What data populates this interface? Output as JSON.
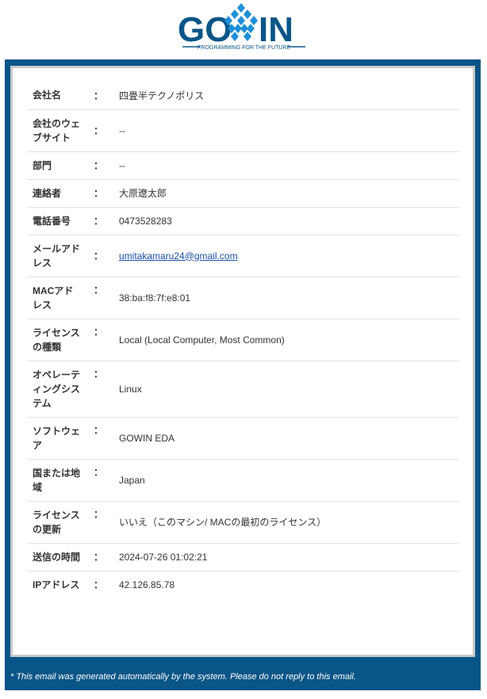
{
  "logo": {
    "text_left": "GO",
    "text_right": "IN",
    "tagline": "PROGRAMMING FOR THE FUTURE",
    "colors": {
      "wordmark": "#0a5587",
      "diamonds": "#1e8fd8"
    }
  },
  "rows": [
    {
      "label": "会社名",
      "value": "四畳半テクノポリス"
    },
    {
      "label": "会社のウェブサイト",
      "value": "--"
    },
    {
      "label": "部門",
      "value": "--"
    },
    {
      "label": "連絡者",
      "value": "大原遼太郎"
    },
    {
      "label": "電話番号",
      "value": "0473528283"
    },
    {
      "label": "メールアドレス",
      "value": "umitakamaru24@gmail.com"
    },
    {
      "label": "MACアドレス",
      "value": "38:ba:f8:7f:e8:01"
    },
    {
      "label": "ライセンスの種類",
      "value": "Local (Local Computer, Most Common)"
    },
    {
      "label": "オペレーティングシステム",
      "value": "Linux"
    },
    {
      "label": "ソフトウェア",
      "value": "GOWIN EDA"
    },
    {
      "label": "国または地域",
      "value": "Japan"
    },
    {
      "label": "ライセンスの更新",
      "value": "いいえ（このマシン/ MACの最初のライセンス）"
    },
    {
      "label": "送信の時間",
      "value": "2024-07-26 01:02:21"
    },
    {
      "label": "IPアドレス",
      "value": "42.126.85.78"
    }
  ],
  "colon": "：",
  "footer": "* This email was generated automatically by the system. Please do not reply to this email.",
  "colors": {
    "frame": "#0a5587",
    "panel_border": "#c9c9c9",
    "link": "#1a4fa6"
  }
}
